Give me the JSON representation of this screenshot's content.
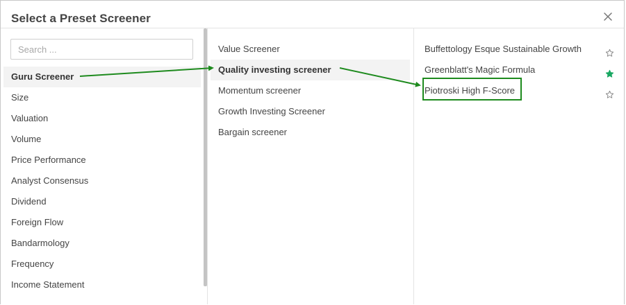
{
  "dialog": {
    "title": "Select a Preset Screener"
  },
  "search": {
    "placeholder": "Search ..."
  },
  "categories": [
    "Guru Screener",
    "Size",
    "Valuation",
    "Volume",
    "Price Performance",
    "Analyst Consensus",
    "Dividend",
    "Foreign Flow",
    "Bandarmology",
    "Frequency",
    "Income Statement"
  ],
  "active_category": "Guru Screener",
  "subcategories": [
    "Value Screener",
    "Quality investing screener",
    "Momentum screener",
    "Growth Investing Screener",
    "Bargain screener"
  ],
  "active_subcategory": "Quality investing screener",
  "presets": [
    {
      "label": "Buffettology Esque Sustainable Growth",
      "starred": false
    },
    {
      "label": "Greenblatt's Magic Formula",
      "starred": true
    },
    {
      "label": "Piotroski High F-Score",
      "starred": false
    }
  ],
  "colors": {
    "annotation_green": "#1d8a1d",
    "star_filled": "#1aa863",
    "star_empty": "#8a8a8a"
  },
  "icons": {
    "close": "close-icon",
    "star_filled": "star-filled-icon",
    "star_outline": "star-outline-icon"
  }
}
